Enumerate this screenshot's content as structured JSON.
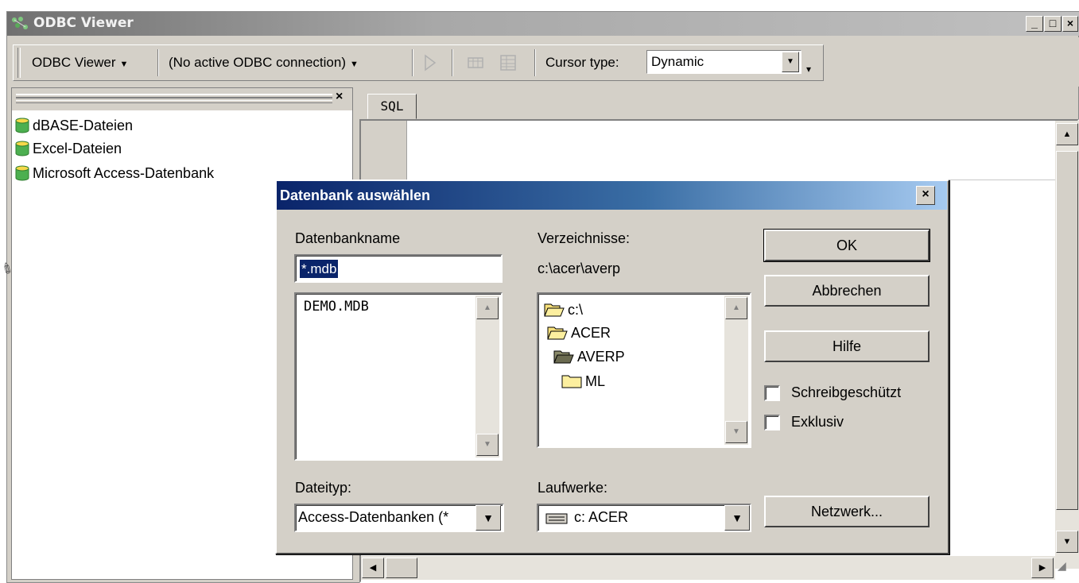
{
  "window": {
    "title": "ODBC Viewer",
    "minimize": "_",
    "maximize": "□",
    "close": "×"
  },
  "toolbar": {
    "viewer_menu": "ODBC Viewer",
    "connection_menu": "(No active ODBC connection)",
    "cursor_label": "Cursor type:",
    "cursor_value": "Dynamic"
  },
  "left_pane": {
    "close": "×",
    "items": [
      "dBASE-Dateien",
      "Excel-Dateien",
      "Microsoft Access-Datenbank"
    ]
  },
  "editor": {
    "tab": "SQL"
  },
  "dialog": {
    "title": "Datenbank auswählen",
    "close": "×",
    "db_name_label": "Datenbankname",
    "db_name_value": "*.mdb",
    "files": [
      "DEMO.MDB"
    ],
    "dirs_label": "Verzeichnisse:",
    "current_dir": "c:\\acer\\averp",
    "dirs": [
      "c:\\",
      "ACER",
      "AVERP",
      "ML"
    ],
    "filetype_label": "Dateityp:",
    "filetype_value": "Access-Datenbanken (*",
    "drives_label": "Laufwerke:",
    "drive_value": "c: ACER",
    "ok": "OK",
    "cancel": "Abbrechen",
    "help": "Hilfe",
    "readonly": "Schreibgeschützt",
    "exclusive": "Exklusiv",
    "network": "Netzwerk..."
  }
}
